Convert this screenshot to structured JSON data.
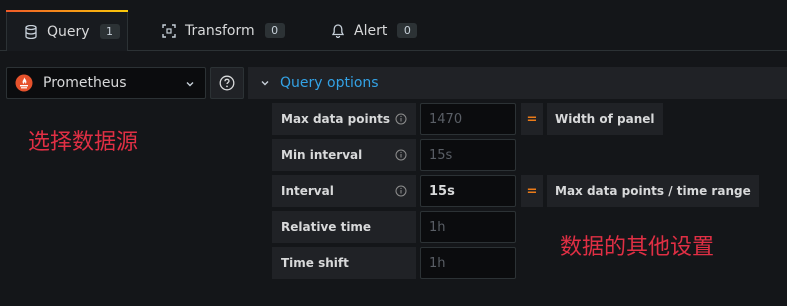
{
  "tabs": [
    {
      "label": "Query",
      "count": "1",
      "icon": "database-icon",
      "active": true
    },
    {
      "label": "Transform",
      "count": "0",
      "icon": "transform-icon",
      "active": false
    },
    {
      "label": "Alert",
      "count": "0",
      "icon": "bell-icon",
      "active": false
    }
  ],
  "datasource": {
    "selected": "Prometheus",
    "icon": "prometheus-logo"
  },
  "query_options": {
    "label": "Query options"
  },
  "rows": [
    {
      "label": "Max data points",
      "value": "",
      "placeholder": "1470",
      "has_info": true,
      "desc": "Width of panel"
    },
    {
      "label": "Min interval",
      "value": "",
      "placeholder": "15s",
      "has_info": true,
      "desc": ""
    },
    {
      "label": "Interval",
      "value": "15s",
      "placeholder": "",
      "has_info": true,
      "desc": "Max data points / time range"
    },
    {
      "label": "Relative time",
      "value": "",
      "placeholder": "1h",
      "has_info": false,
      "desc": ""
    },
    {
      "label": "Time shift",
      "value": "",
      "placeholder": "1h",
      "has_info": false,
      "desc": ""
    }
  ],
  "eq_symbol": "=",
  "annotations": {
    "select_source": "选择数据源",
    "data_settings": "数据的其他设置"
  },
  "colors": {
    "accent_blue": "#33a2e5",
    "annotation_red": "#e02f44",
    "eq_orange": "#eb7b18"
  }
}
